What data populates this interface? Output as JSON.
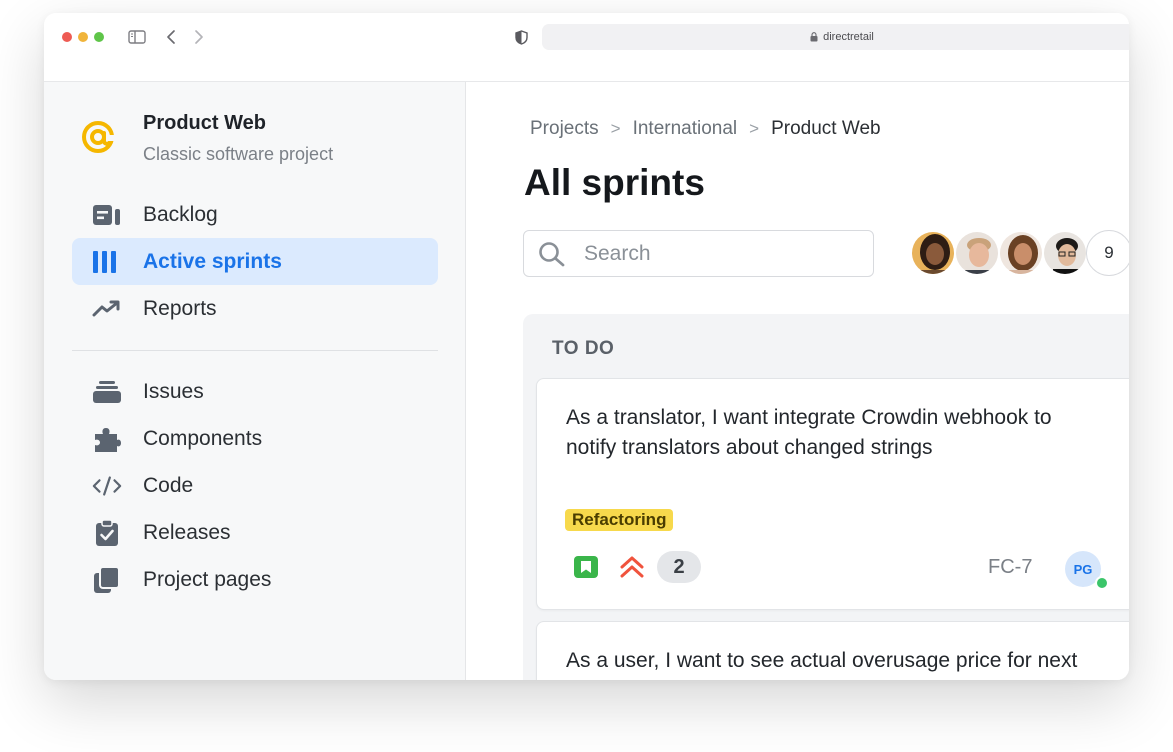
{
  "browser": {
    "url": "directretail"
  },
  "project": {
    "name": "Product Web",
    "subtitle": "Classic software project",
    "accent_color": "#f5b700"
  },
  "sidebar": {
    "items": [
      {
        "label": "Backlog",
        "icon": "backlog-icon",
        "active": false
      },
      {
        "label": "Active sprints",
        "icon": "columns-icon",
        "active": true
      },
      {
        "label": "Reports",
        "icon": "trending-up-icon",
        "active": false
      },
      {
        "label": "Issues",
        "icon": "stack-icon",
        "active": false
      },
      {
        "label": "Components",
        "icon": "puzzle-icon",
        "active": false
      },
      {
        "label": "Code",
        "icon": "code-icon",
        "active": false
      },
      {
        "label": "Releases",
        "icon": "clipboard-check-icon",
        "active": false
      },
      {
        "label": "Project pages",
        "icon": "pages-icon",
        "active": false
      }
    ]
  },
  "breadcrumb": {
    "items": [
      "Projects",
      "International",
      "Product Web"
    ],
    "separator": ">"
  },
  "page": {
    "title": "All sprints"
  },
  "search": {
    "placeholder": "Search"
  },
  "team": {
    "extra_count": "9"
  },
  "board": {
    "columns": [
      {
        "title": "TO DO",
        "cards": [
          {
            "summary": "As a translator, I want integrate Crowdin webhook to notify translators about changed strings",
            "label": "Refactoring",
            "type_icon": "story-icon",
            "priority_icon": "priority-highest-icon",
            "votes": "2",
            "key": "FC-7",
            "assignee": "PG"
          },
          {
            "summary": "As a user, I want to see actual overusage price for next download"
          }
        ]
      }
    ]
  },
  "colors": {
    "active_nav": "#1a73e8",
    "active_nav_bg": "#dbeafe",
    "tag_bg": "#f7d94c",
    "story_green": "#3ab54a",
    "priority_red": "#f0533d"
  }
}
